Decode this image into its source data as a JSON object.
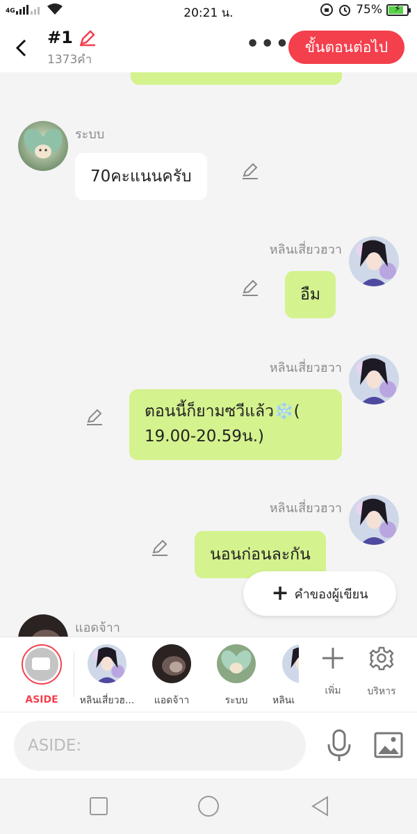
{
  "statusbar": {
    "network": "4G",
    "time": "20:21 น.",
    "battery": "75%",
    "battery_level": 0.75
  },
  "header": {
    "title": "#1",
    "word_count": "1373คำ",
    "next_button": "ขั้นตอนต่อไป",
    "accent_color": "#f43f4d"
  },
  "messages": [
    {
      "sender": "ระบบ",
      "text": "70คะแนนครับ",
      "side": "left",
      "bubble": "white"
    },
    {
      "sender": "หลินเสี่ยวฮวา",
      "text": "อืม",
      "side": "right",
      "bubble": "green"
    },
    {
      "sender": "หลินเสี่ยวฮวา",
      "text_line1": "ตอนนี้ก็ยามซวีแล้ว❄️(",
      "text_line2": "19.00-20.59น.)",
      "side": "right",
      "bubble": "green"
    },
    {
      "sender": "หลินเสี่ยวฮวา",
      "text": "นอนก่อนละกัน",
      "side": "right",
      "bubble": "green"
    },
    {
      "sender": "แอดจ้าา",
      "side": "left"
    }
  ],
  "float_button": {
    "icon": "+",
    "label": "คำของผู้เขียน"
  },
  "characters": [
    {
      "label": "ASIDE"
    },
    {
      "label": "หลินเสี่ยวฮ..."
    },
    {
      "label": "แอดจ้าา"
    },
    {
      "label": "ระบบ"
    },
    {
      "label": "หลินเ"
    }
  ],
  "tools": {
    "add_label": "เพิ่ม",
    "manage_label": "บริหาร"
  },
  "input": {
    "placeholder": "ASIDE:"
  },
  "colors": {
    "green_bubble": "#d4f28e",
    "accent": "#f43f4d"
  }
}
